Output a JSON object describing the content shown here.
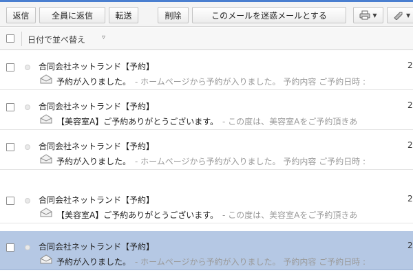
{
  "toolbar": {
    "reply_label": "返信",
    "reply_all_label": "全員に返信",
    "forward_label": "転送",
    "delete_label": "削除",
    "spam_label": "このメールを迷惑メールとする",
    "print_icon": "print-icon",
    "tag_icon": "tag-icon"
  },
  "sortbar": {
    "label": "日付で並べ替え",
    "arrow": "▿"
  },
  "messages": [
    {
      "sender": "合同会社ネットランド【予約】",
      "date": "2",
      "subject": "予約が入りました。",
      "preview": "- ホームページから予約が入りました。 予約内容 ご予約日時 :",
      "selected": false
    },
    {
      "sender": "合同会社ネットランド【予約】",
      "date": "2",
      "subject": "【美容室A】ご予約ありがとうございます。",
      "preview": "- この度は、美容室Aをご予約頂きあ",
      "selected": false
    },
    {
      "sender": "合同会社ネットランド【予約】",
      "date": "2",
      "subject": "予約が入りました。",
      "preview": "- ホームページから予約が入りました。 予約内容 ご予約日時 :",
      "selected": false
    },
    {
      "sender": "合同会社ネットランド【予約】",
      "date": "2",
      "subject": "【美容室A】ご予約ありがとうございます。",
      "preview": "- この度は、美容室Aをご予約頂きあ",
      "selected": false
    },
    {
      "sender": "合同会社ネットランド【予約】",
      "date": "2",
      "subject": "予約が入りました。",
      "preview": "- ホームページから予約が入りました。 予約内容 ご予約日時 :",
      "selected": true
    }
  ],
  "colors": {
    "accent": "#4a7fd0",
    "selected_row": "#b5c8e4",
    "preview_text": "#9a9a9a"
  }
}
